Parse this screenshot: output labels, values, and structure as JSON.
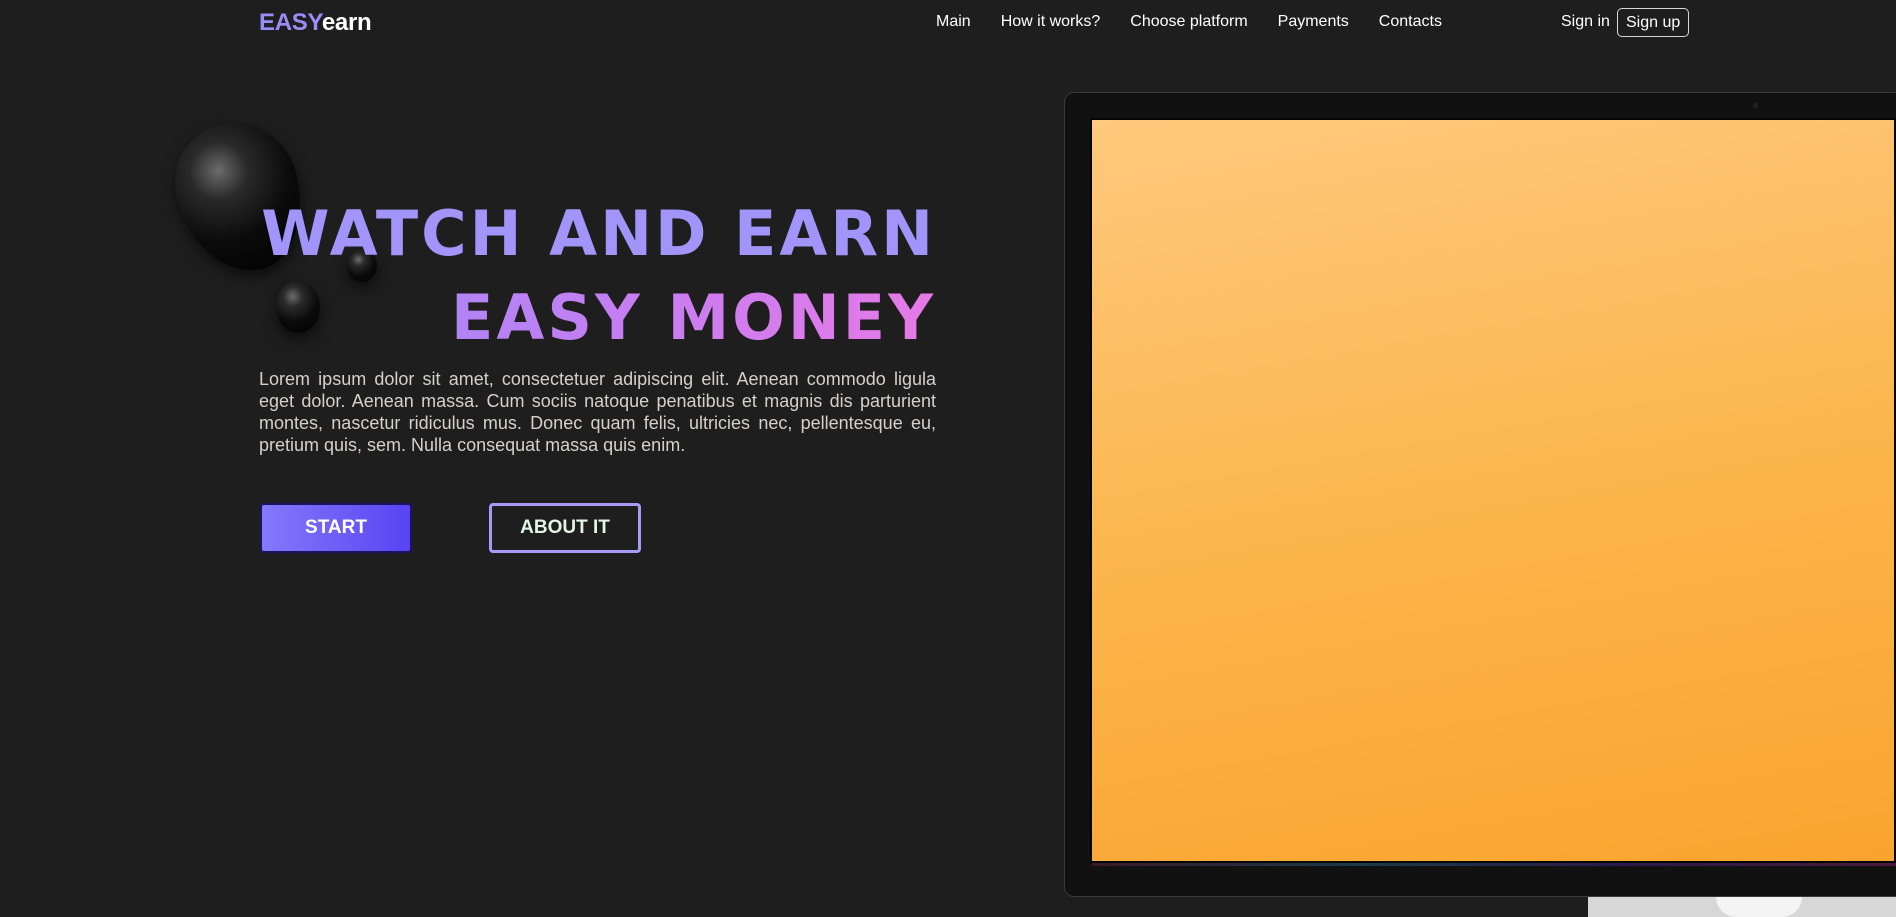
{
  "logo": {
    "part1": "EASY",
    "part2": "earn"
  },
  "nav": {
    "items": [
      {
        "label": "Main"
      },
      {
        "label": "How it works?"
      },
      {
        "label": "Choose platform"
      },
      {
        "label": "Payments"
      },
      {
        "label": "Contacts"
      }
    ],
    "sign_in": "Sign in",
    "sign_up": "Sign up"
  },
  "hero": {
    "title_line1": "WATCH AND EARN",
    "title_line2": "EASY MONEY",
    "description": "Lorem ipsum dolor sit amet, consectetuer adipiscing elit. Aenean commodo ligula eget dolor. Aenean massa. Cum sociis natoque penatibus et magnis dis parturient montes, nascetur ridiculus mus. Donec quam felis, ultricies nec, pellentesque eu, pretium quis, sem. Nulla consequat massa quis enim.",
    "start_label": "START",
    "about_label": "ABOUT IT"
  },
  "colors": {
    "background": "#1e1e1e",
    "accent_purple": "#a294f9",
    "accent_pink": "#e679e6",
    "screen_orange": "#fcb449"
  }
}
